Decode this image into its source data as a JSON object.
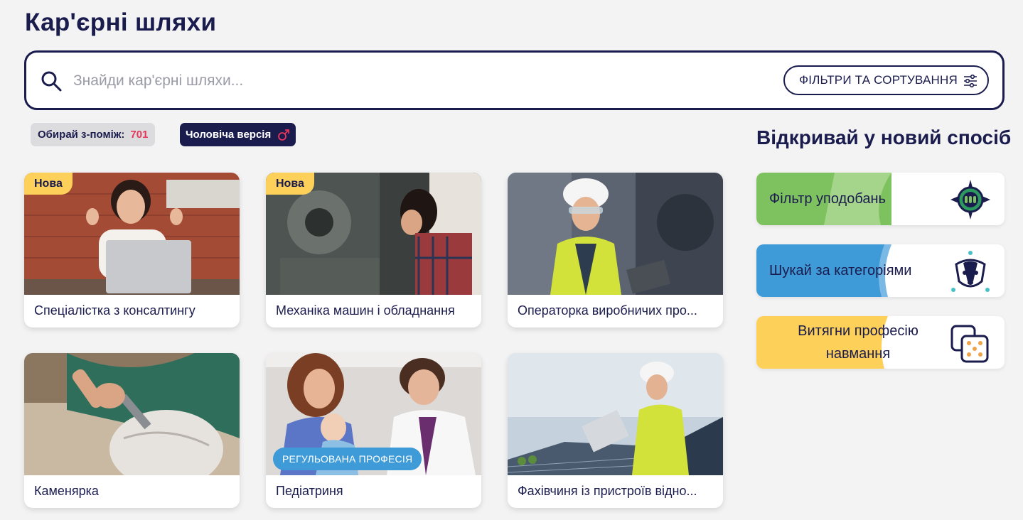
{
  "page": {
    "title": "Кар'єрні шляхи"
  },
  "search": {
    "placeholder": "Знайди кар'єрні шляхи...",
    "value": "",
    "filters_label": "ФІЛЬТРИ ТА СОРТУВАННЯ"
  },
  "badges": {
    "count_label": "Обирай з-поміж:",
    "count_value": "701",
    "version_label": "Чоловіча версія"
  },
  "cards": [
    {
      "title": "Спеціалістка з консалтингу",
      "badge": "Нова"
    },
    {
      "title": "Механіка машин і обладнання",
      "badge": "Нова"
    },
    {
      "title": "Операторка виробничих про...",
      "badge": ""
    },
    {
      "title": "Каменярка",
      "badge": ""
    },
    {
      "title": "Педіатриня",
      "badge": "РЕГУЛЬОВАНА ПРОФЕСІЯ"
    },
    {
      "title": "Фахівчиня із пристроїв відно...",
      "badge": ""
    }
  ],
  "side": {
    "title": "Відкривай у новий спосіб",
    "items": [
      {
        "label": "Фільтр уподобань",
        "icon": "compass-icon",
        "color": "#7ec25f"
      },
      {
        "label": "Шукай за категоріями",
        "icon": "badger-icon",
        "color": "#3e9bd8"
      },
      {
        "label": "Витягни професію навмання",
        "icon": "dice-icon",
        "color": "#fdd05a"
      }
    ]
  },
  "colors": {
    "navy": "#1b1c4e",
    "accent_red": "#e8365a",
    "new_yellow": "#fdd05a",
    "regulated_blue": "#3e9bd8"
  }
}
